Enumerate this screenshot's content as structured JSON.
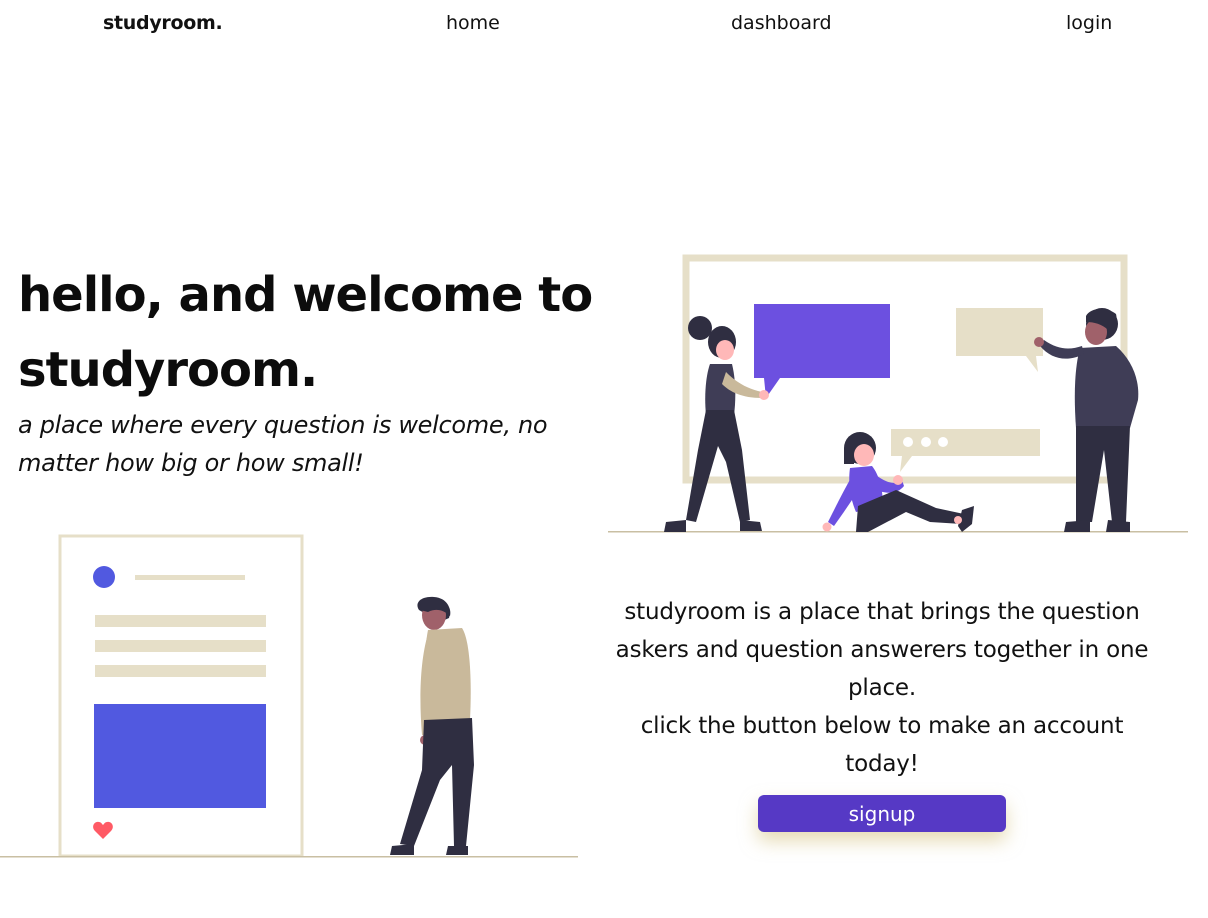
{
  "nav": {
    "brand": "studyroom.",
    "home": "home",
    "dashboard": "dashboard",
    "login": "login"
  },
  "hero": {
    "title": "hello, and welcome to studyroom.",
    "subtitle": "a place where every question is welcome, no matter how big or how small!"
  },
  "blurb": {
    "line1": "studyroom is a place that brings the question askers and question answerers together in one place.",
    "line2": "click the button below to make an account today!"
  },
  "signup": {
    "label": "signup"
  },
  "colors": {
    "accent": "#5639c5",
    "illustration_purple": "#6c50e0",
    "illustration_blue": "#5159e0",
    "beige": "#e6dfc8",
    "dark": "#2f2e41",
    "heart": "#ff5a65"
  },
  "icons": {
    "like": "heart-icon"
  }
}
